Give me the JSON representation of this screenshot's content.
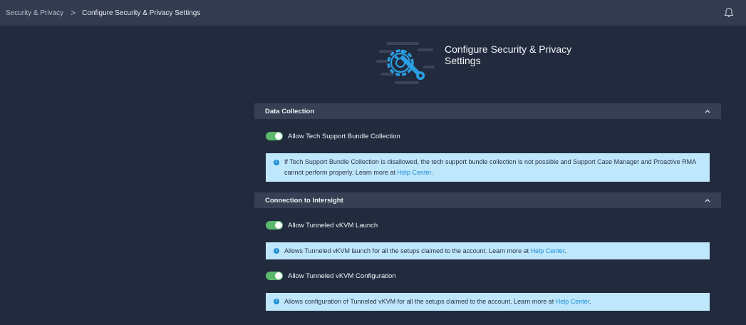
{
  "breadcrumb": {
    "parent": "Security & Privacy",
    "separator": ">",
    "current": "Configure Security & Privacy Settings"
  },
  "page": {
    "title": "Configure Security & Privacy Settings"
  },
  "sections": [
    {
      "title": "Data Collection",
      "toggles": [
        {
          "label": "Allow Tech Support Bundle Collection",
          "enabled": true,
          "info_text": "If Tech Support Bundle Collection is disallowed, the tech support bundle collection is not possible and Support Case Manager and Proactive RMA cannot perform properly. Learn more at ",
          "info_link": "Help Center",
          "info_suffix": "."
        }
      ]
    },
    {
      "title": "Connection to Intersight",
      "toggles": [
        {
          "label": "Allow Tunneled vKVM Launch",
          "enabled": true,
          "info_text": "Allows Tunneled vKVM launch for all the setups claimed to the account. Learn more at ",
          "info_link": "Help Center",
          "info_suffix": "."
        },
        {
          "label": "Allow Tunneled vKVM Configuration",
          "enabled": true,
          "info_text": "Allows configuration of Tunneled vKVM for all the setups claimed to the account. Learn more at ",
          "info_link": "Help Center",
          "info_suffix": "."
        }
      ]
    }
  ],
  "icons": {
    "bell": "bell-icon",
    "chevron": "chevron-up-icon",
    "hero": "gear-wrench-icon",
    "info": "info-icon"
  },
  "colors": {
    "background": "#222b3e",
    "topbar": "#323b4f",
    "section_header": "#363f53",
    "toggle_on": "#5bb96d",
    "info_bg": "#bfe7fb",
    "link": "#1a8fd6",
    "accent_blue": "#2a9fe3"
  }
}
